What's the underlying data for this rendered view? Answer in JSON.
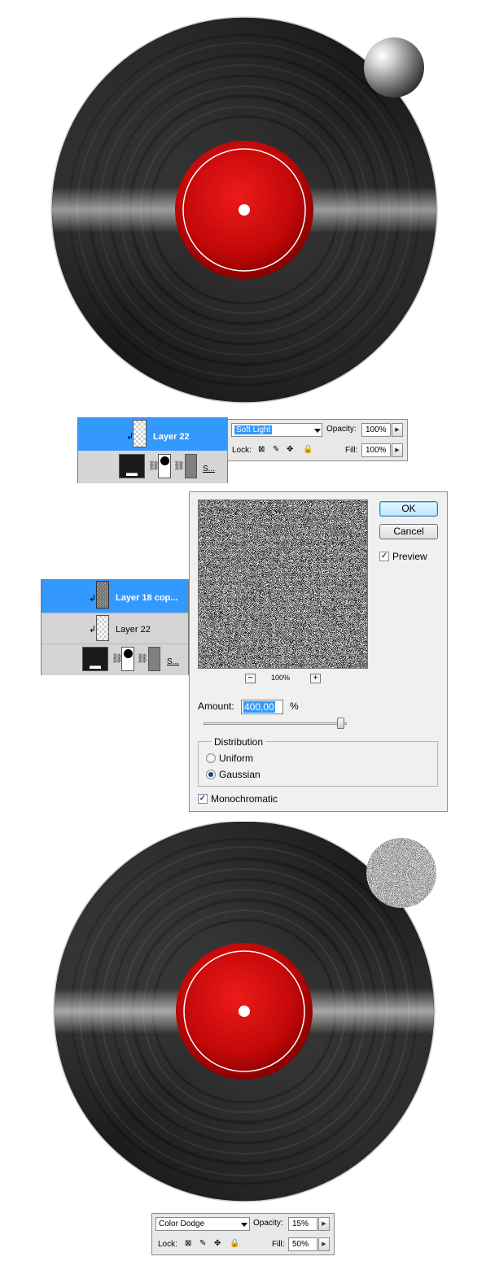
{
  "panel1": {
    "layer_name": "Layer 22",
    "sub_label": "S..."
  },
  "blend1": {
    "mode": "Soft Light",
    "opacity_label": "Opacity:",
    "opacity": "100%",
    "lock_label": "Lock:",
    "fill_label": "Fill:",
    "fill": "100%"
  },
  "panel2": {
    "layer1_name": "Layer 18 cop...",
    "layer2_name": "Layer 22",
    "sub_label": "S..."
  },
  "dialog": {
    "ok_label": "OK",
    "cancel_label": "Cancel",
    "preview_label": "Preview",
    "preview_checked": true,
    "zoom_out": "−",
    "zoom_level": "100%",
    "zoom_in": "+",
    "amount_label": "Amount:",
    "amount_value": "400,00",
    "amount_unit": "%",
    "amount_slider_fraction": 0.95,
    "distribution_label": "Distribution",
    "uniform_label": "Uniform",
    "gaussian_label": "Gaussian",
    "selected_distribution": "Gaussian",
    "monochromatic_label": "Monochromatic",
    "monochromatic_checked": true
  },
  "blend2": {
    "mode": "Color Dodge",
    "opacity_label": "Opacity:",
    "opacity": "15%",
    "lock_label": "Lock:",
    "fill_label": "Fill:",
    "fill": "50%"
  },
  "colors": {
    "selection_blue": "#3399ff",
    "label_red": "#d40000",
    "vinyl_black": "#1c1c1c"
  }
}
